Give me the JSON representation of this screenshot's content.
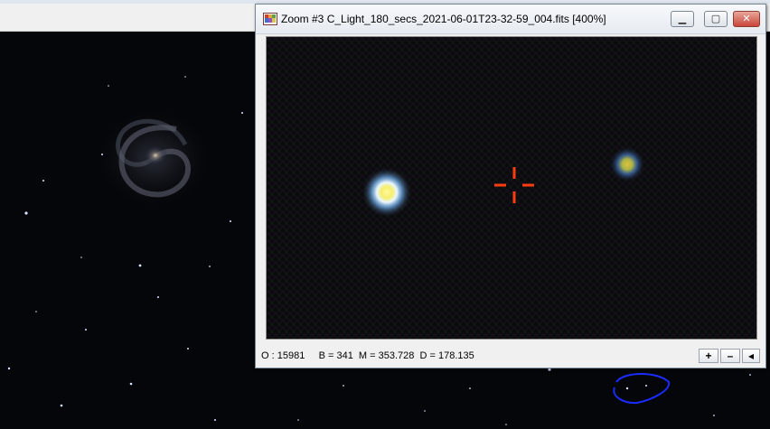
{
  "zoom_window": {
    "title": "Zoom #3 C_Light_180_secs_2021-06-01T23-32-59_004.fits  [400%]",
    "controls": {
      "minimize_icon": "minimize-icon",
      "maximize_icon": "maximize-icon",
      "close_icon": "close-icon"
    },
    "status": {
      "text": "O : 15981     B = 341  M = 353.728  D = 178.135"
    },
    "zoom_in_label": "+",
    "zoom_out_label": "–",
    "scroll_left_label": "◂"
  },
  "colors": {
    "crosshair": "#ff3c10",
    "annotation_circle": "#1a2cff"
  }
}
